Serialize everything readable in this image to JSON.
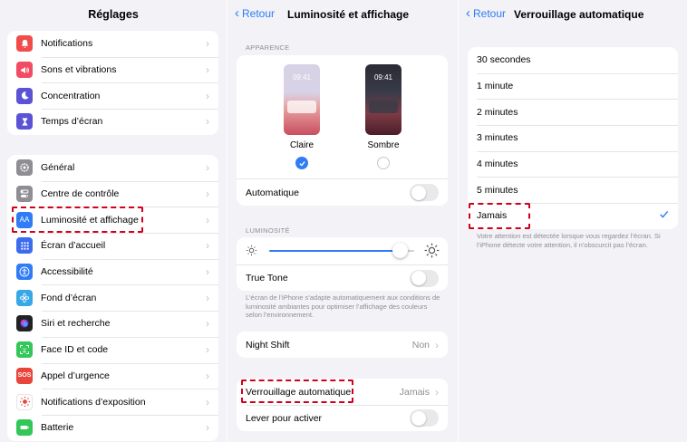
{
  "settings": {
    "title": "Réglages",
    "group1": [
      {
        "label": "Notifications",
        "icon": "bell-icon",
        "color": "#f24b4b"
      },
      {
        "label": "Sons et vibrations",
        "icon": "speaker-icon",
        "color": "#f24b63"
      },
      {
        "label": "Concentration",
        "icon": "moon-icon",
        "color": "#5b52d6"
      },
      {
        "label": "Temps d’écran",
        "icon": "hourglass-icon",
        "color": "#5b52d6"
      }
    ],
    "group2": [
      {
        "label": "Général",
        "icon": "gear-icon",
        "color": "#8e8e93"
      },
      {
        "label": "Centre de contrôle",
        "icon": "toggles-icon",
        "color": "#8e8e93"
      },
      {
        "label": "Luminosité et affichage",
        "icon": "text-size-icon",
        "color": "#2f7cf6"
      },
      {
        "label": "Écran d’accueil",
        "icon": "grid-icon",
        "color": "#3d6bf0"
      },
      {
        "label": "Accessibilité",
        "icon": "accessibility-icon",
        "color": "#2f7cf6"
      },
      {
        "label": "Fond d’écran",
        "icon": "flower-icon",
        "color": "#37a7e8"
      },
      {
        "label": "Siri et recherche",
        "icon": "siri-icon",
        "color": "#222222"
      },
      {
        "label": "Face ID et code",
        "icon": "face-id-icon",
        "color": "#33c658"
      },
      {
        "label": "Appel d’urgence",
        "icon": "sos-icon",
        "color": "#e8453c"
      },
      {
        "label": "Notifications d’exposition",
        "icon": "exposure-icon",
        "color": "#ffffff"
      },
      {
        "label": "Batterie",
        "icon": "battery-icon",
        "color": "#33c658"
      }
    ]
  },
  "display": {
    "back": "Retour",
    "title": "Luminosité et affichage",
    "appearance_header": "APPARENCE",
    "time": "09:41",
    "light_label": "Claire",
    "dark_label": "Sombre",
    "automatic": "Automatique",
    "brightness_header": "LUMINOSITÉ",
    "brightness_level": 0.9,
    "true_tone": "True Tone",
    "true_tone_note": "L’écran de l’iPhone s’adapte automatiquement aux conditions de luminosité ambiantes pour optimiser l’affichage des couleurs selon l’environnement.",
    "night_shift": "Night Shift",
    "night_shift_value": "Non",
    "auto_lock": "Verrouillage automatique",
    "auto_lock_value": "Jamais",
    "raise_to_wake": "Lever pour activer"
  },
  "autolock": {
    "back": "Retour",
    "title": "Verrouillage automatique",
    "options": [
      "30 secondes",
      "1 minute",
      "2 minutes",
      "3 minutes",
      "4 minutes",
      "5 minutes",
      "Jamais"
    ],
    "selected": "Jamais",
    "note": "Votre attention est détectée lorsque vous regardez l’écran. Si l’iPhone détecte votre attention, il n’obscurcit pas l’écran."
  },
  "colors": {
    "accent": "#2f7cf6",
    "highlight": "#d0011b"
  }
}
